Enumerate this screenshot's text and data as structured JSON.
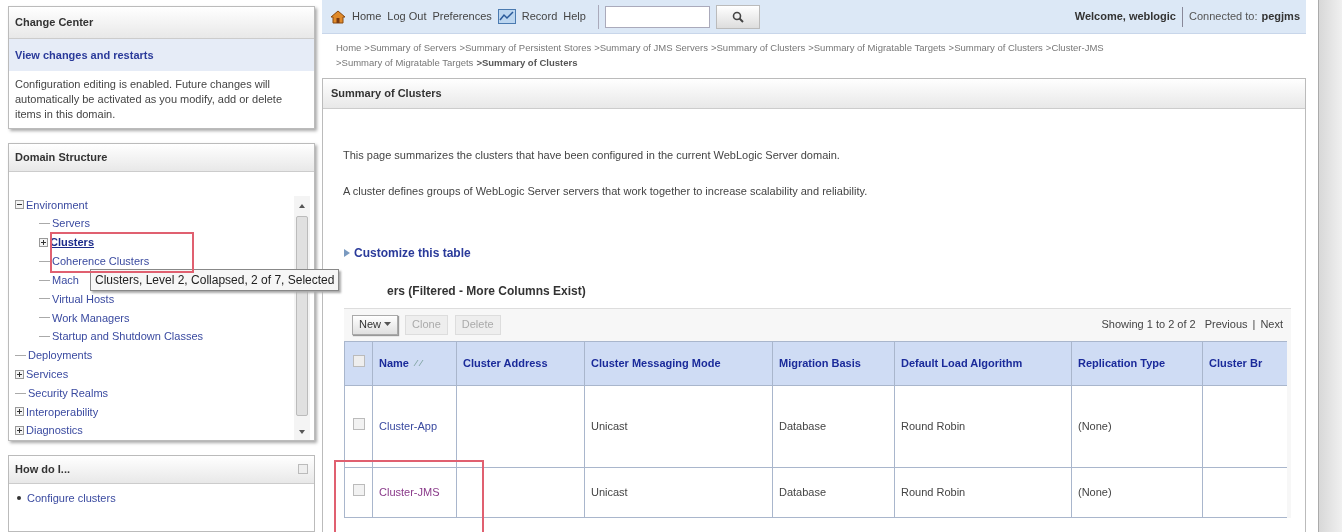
{
  "change_center": {
    "title": "Change Center",
    "link": "View changes and restarts",
    "message": "Configuration editing is enabled. Future changes will automatically be activated as you modify, add or delete items in this domain."
  },
  "domain_structure": {
    "title": "Domain Structure",
    "tree": [
      {
        "label": "Environment",
        "expanded": true,
        "selected": false,
        "children": [
          {
            "label": "Servers",
            "selected": false
          },
          {
            "label": "Clusters",
            "expanded": false,
            "selected": true
          },
          {
            "label": "Coherence Clusters",
            "selected": false
          },
          {
            "label": "Mach",
            "selected": false
          },
          {
            "label": "Virtual Hosts",
            "selected": false
          },
          {
            "label": "Work Managers",
            "selected": false
          },
          {
            "label": "Startup and Shutdown Classes",
            "selected": false
          }
        ]
      },
      {
        "label": "Deployments",
        "selected": false
      },
      {
        "label": "Services",
        "expanded": false,
        "selected": false
      },
      {
        "label": "Security Realms",
        "selected": false
      },
      {
        "label": "Interoperability",
        "expanded": false,
        "selected": false
      },
      {
        "label": "Diagnostics",
        "expanded": false,
        "selected": false
      }
    ]
  },
  "tooltip": "Clusters, Level 2, Collapsed, 2 of 7, Selected",
  "how_do_i": {
    "title": "How do I...",
    "items": [
      "Configure clusters"
    ]
  },
  "toolbar": {
    "links": [
      "Home",
      "Log Out",
      "Preferences",
      "Record",
      "Help"
    ],
    "welcome": "Welcome, weblogic",
    "connected_label": "Connected to:",
    "connected_value": "pegjms"
  },
  "breadcrumb": [
    "Home",
    ">Summary of Servers",
    ">Summary of Persistent Stores",
    ">Summary of JMS Servers",
    ">Summary of Clusters",
    ">Summary of Migratable Targets",
    ">Summary of Clusters",
    ">Cluster-JMS",
    ">Summary of Migratable Targets",
    ">Summary of Clusters"
  ],
  "panel": {
    "title": "Summary of Clusters",
    "paragraphs": [
      "This page summarizes the clusters that have been configured in the current WebLogic Server domain.",
      "A cluster defines groups of WebLogic Server servers that work together to increase scalability and reliability."
    ],
    "customize_link": "Customize this table",
    "table_title": "ers (Filtered - More Columns Exist)",
    "buttons": [
      {
        "label": "New",
        "disabled": false,
        "dropdown": true
      },
      {
        "label": "Clone",
        "disabled": true,
        "dropdown": false
      },
      {
        "label": "Delete",
        "disabled": true,
        "dropdown": false
      }
    ],
    "paging": {
      "showing": "Showing 1 to 2 of 2",
      "previous": "Previous",
      "separator": "|",
      "next": "Next"
    },
    "table": {
      "select_all_checked": false,
      "columns": [
        "Name",
        "Cluster Address",
        "Cluster Messaging Mode",
        "Migration Basis",
        "Default Load Algorithm",
        "Replication Type",
        "Cluster Br"
      ],
      "rows": [
        {
          "checked": false,
          "visited": false,
          "cells": [
            "Cluster-App",
            "",
            "Unicast",
            "Database",
            "Round Robin",
            "(None)",
            ""
          ]
        },
        {
          "checked": false,
          "visited": true,
          "cells": [
            "Cluster-JMS",
            "",
            "Unicast",
            "Database",
            "Round Robin",
            "(None)",
            ""
          ]
        }
      ]
    }
  }
}
